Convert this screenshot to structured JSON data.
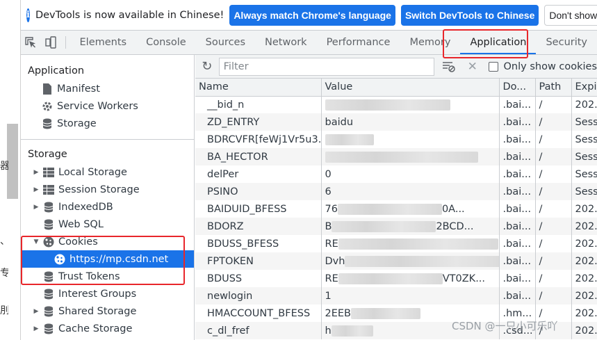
{
  "page_fragments": [
    "器",
    "、",
    "专",
    "刖"
  ],
  "infobar": {
    "message": "DevTools is now available in Chinese!",
    "btn_match": "Always match Chrome's language",
    "btn_switch": "Switch DevTools to Chinese",
    "btn_dont_show": "Don't show ag"
  },
  "tabs": [
    {
      "label": "Elements"
    },
    {
      "label": "Console"
    },
    {
      "label": "Sources"
    },
    {
      "label": "Network"
    },
    {
      "label": "Performance"
    },
    {
      "label": "Memory"
    },
    {
      "label": "Application"
    },
    {
      "label": "Security"
    }
  ],
  "sidebar": {
    "application_title": "Application",
    "application_items": [
      "Manifest",
      "Service Workers",
      "Storage"
    ],
    "storage_title": "Storage",
    "storage_items": [
      "Local Storage",
      "Session Storage",
      "IndexedDB",
      "Web SQL",
      "Cookies",
      "https://mp.csdn.net",
      "Trust Tokens",
      "Interest Groups",
      "Shared Storage",
      "Cache Storage"
    ]
  },
  "toolbar": {
    "filter_placeholder": "Filter",
    "only_show_label": "Only show cookies"
  },
  "table": {
    "headers": [
      "Name",
      "Value",
      "Do...",
      "Path",
      "Expi..."
    ],
    "rows": [
      [
        "__bid_n",
        "",
        ".bai...",
        "/",
        "202..."
      ],
      [
        "ZD_ENTRY",
        "baidu",
        ".bai...",
        "/",
        "Sess..."
      ],
      [
        "BDRCVFR[feWj1Vr5u3...",
        "",
        ".bai...",
        "/",
        "Sess..."
      ],
      [
        "BA_HECTOR",
        "",
        ".bai...",
        "/",
        "Sess..."
      ],
      [
        "delPer",
        "0",
        ".bai...",
        "/",
        "Sess..."
      ],
      [
        "PSINO",
        "6",
        ".bai...",
        "/",
        "Sess..."
      ],
      [
        "BAIDUID_BFESS",
        "76",
        ".bai...",
        "/",
        "202..."
      ],
      [
        "BDORZ",
        "B",
        ".bai...",
        "/",
        "202..."
      ],
      [
        "BDUSS_BFESS",
        "RE",
        ".bai...",
        "/",
        "202..."
      ],
      [
        "FPTOKEN",
        "Dvh",
        ".bai...",
        "/",
        "202..."
      ],
      [
        "BDUSS",
        "RE",
        ".bai...",
        "/",
        "202..."
      ],
      [
        "newlogin",
        "1",
        ".bai...",
        "/",
        "202..."
      ],
      [
        "HMACCOUNT_BFESS",
        "2EEB",
        ".hm...",
        "/",
        "202..."
      ],
      [
        "c_dl_fref",
        "h",
        ".csd...",
        "/",
        "202..."
      ]
    ],
    "value_suffixes": {
      "6": "0A...",
      "7": "2BCD...",
      "10": "VT0ZK..."
    }
  },
  "watermark": "CSDN @一只小可乐吖",
  "colors": {
    "accent": "#1a73e8",
    "annotation": "#e8262b",
    "selected": "#1a73e8"
  }
}
